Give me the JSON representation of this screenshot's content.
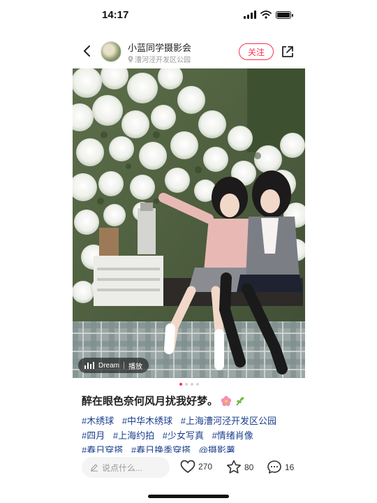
{
  "status": {
    "time": "14:17"
  },
  "header": {
    "author": "小蓝同学摄影会",
    "location": "漕河泾开发区公园",
    "follow_label": "关注"
  },
  "photo": {
    "music_name": "Dream",
    "music_action": "播放",
    "page_count": 4,
    "active_page": 1
  },
  "post": {
    "title": "醉在眼色奈何风月扰我好梦。",
    "tags": [
      "#木绣球",
      "#中华木绣球",
      "#上海漕河泾开发区公园",
      "#四月",
      "#上海约拍",
      "#少女写真",
      "#情绪肖像",
      "#春日穿搭",
      "#春日换季穿搭",
      "@摄影薯"
    ]
  },
  "bottom": {
    "comment_placeholder": "说点什么...",
    "likes": "270",
    "stars": "80",
    "comments": "16"
  },
  "colors": {
    "accent": "#ff2e4d",
    "tag": "#1b3f8f"
  }
}
